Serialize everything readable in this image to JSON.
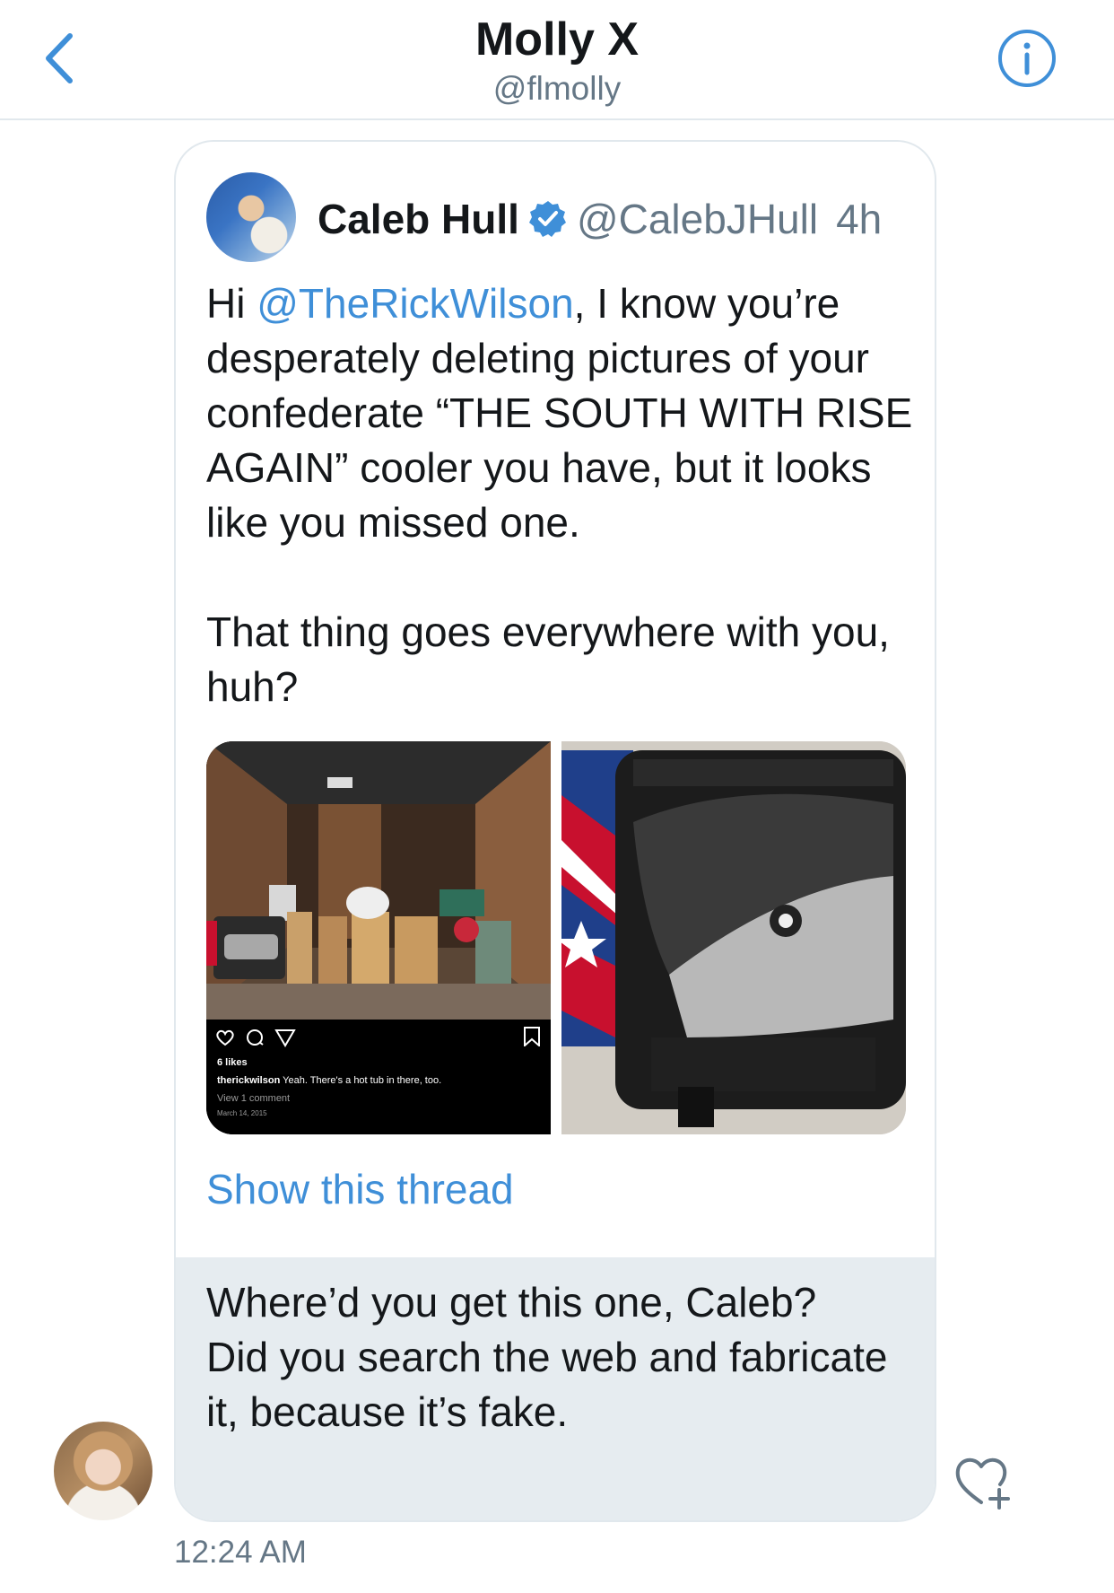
{
  "header": {
    "title": "Molly X",
    "handle": "@flmolly",
    "back_icon": "chevron-left-icon",
    "info_icon": "info-icon"
  },
  "quoted_tweet": {
    "author_name": "Caleb Hull",
    "author_handle": "@CalebJHull",
    "time": "4h",
    "verified": true,
    "text_prefix": "Hi ",
    "mention": "@TheRickWilson",
    "text_rest": ", I know you’re desperately deleting pictures of your confederate “THE SOUTH WITH RISE AGAIN” cooler you have, but it looks like you missed one.",
    "text_second": "That thing goes everywhere with you, huh?",
    "show_thread": "Show this thread",
    "instagram": {
      "likes": "6 likes",
      "caption_user": "therickwilson",
      "caption_text": " Yeah. There's a hot tub in there, too.",
      "comments": "View 1 comment",
      "date": "March 14, 2015"
    }
  },
  "message": {
    "text": "Where’d you get this one, Caleb? Did you search the web and fabricate it, because it’s fake.",
    "timestamp": "12:24 AM"
  },
  "colors": {
    "accent": "#3f8fd8",
    "bubble_bg": "#e6ecf0",
    "secondary_text": "#657786"
  }
}
